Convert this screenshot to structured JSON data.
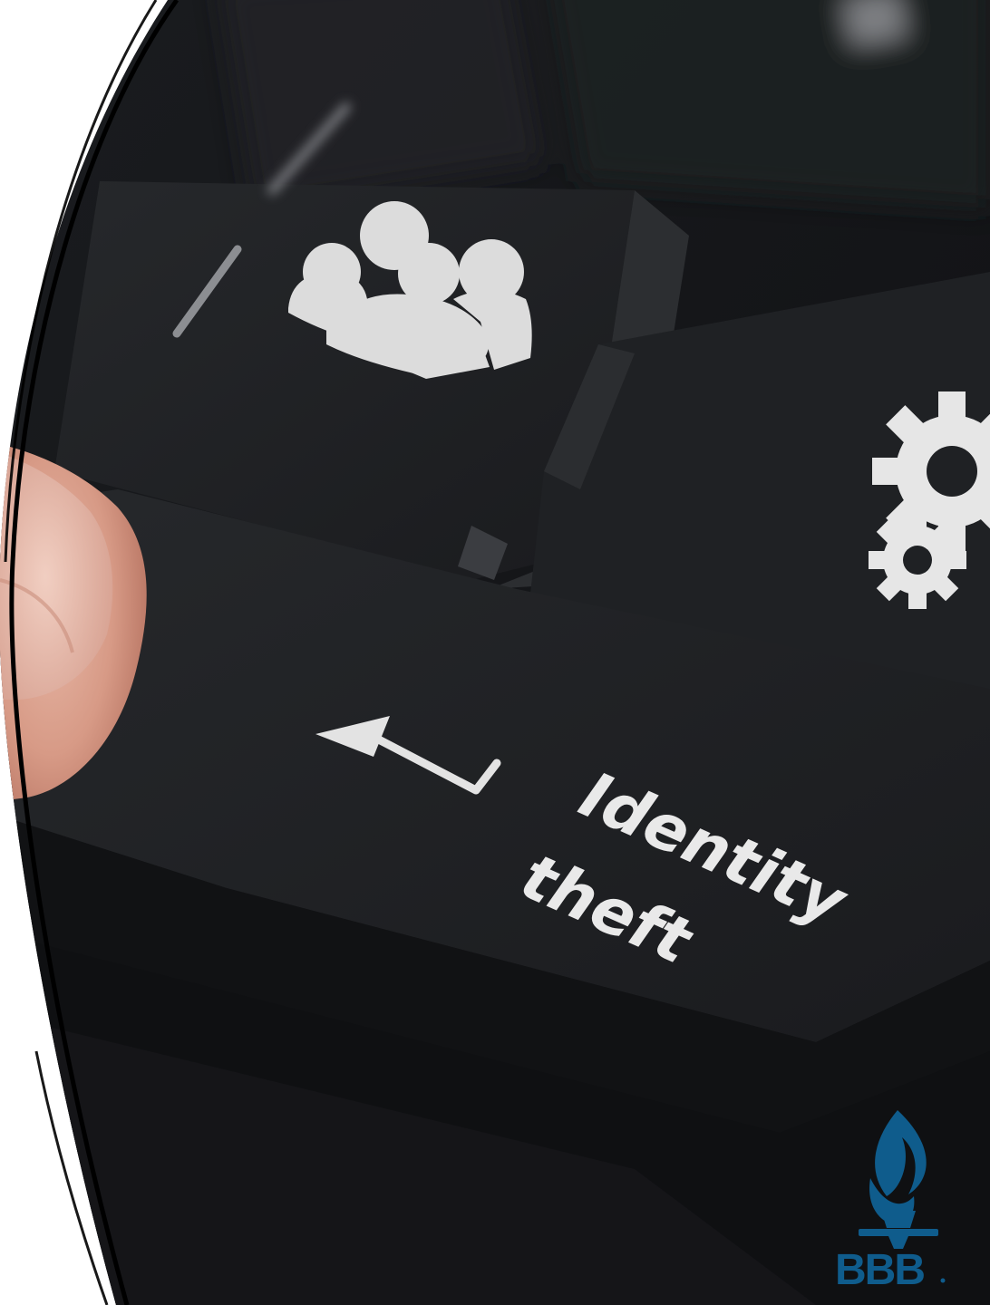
{
  "key_label": {
    "line1": "Identity",
    "line2": "theft"
  },
  "logo": {
    "text": "BBB",
    "color": "#0f5c8c"
  },
  "icons": [
    "enter-arrow-icon",
    "users-group-icon",
    "gears-icon"
  ]
}
